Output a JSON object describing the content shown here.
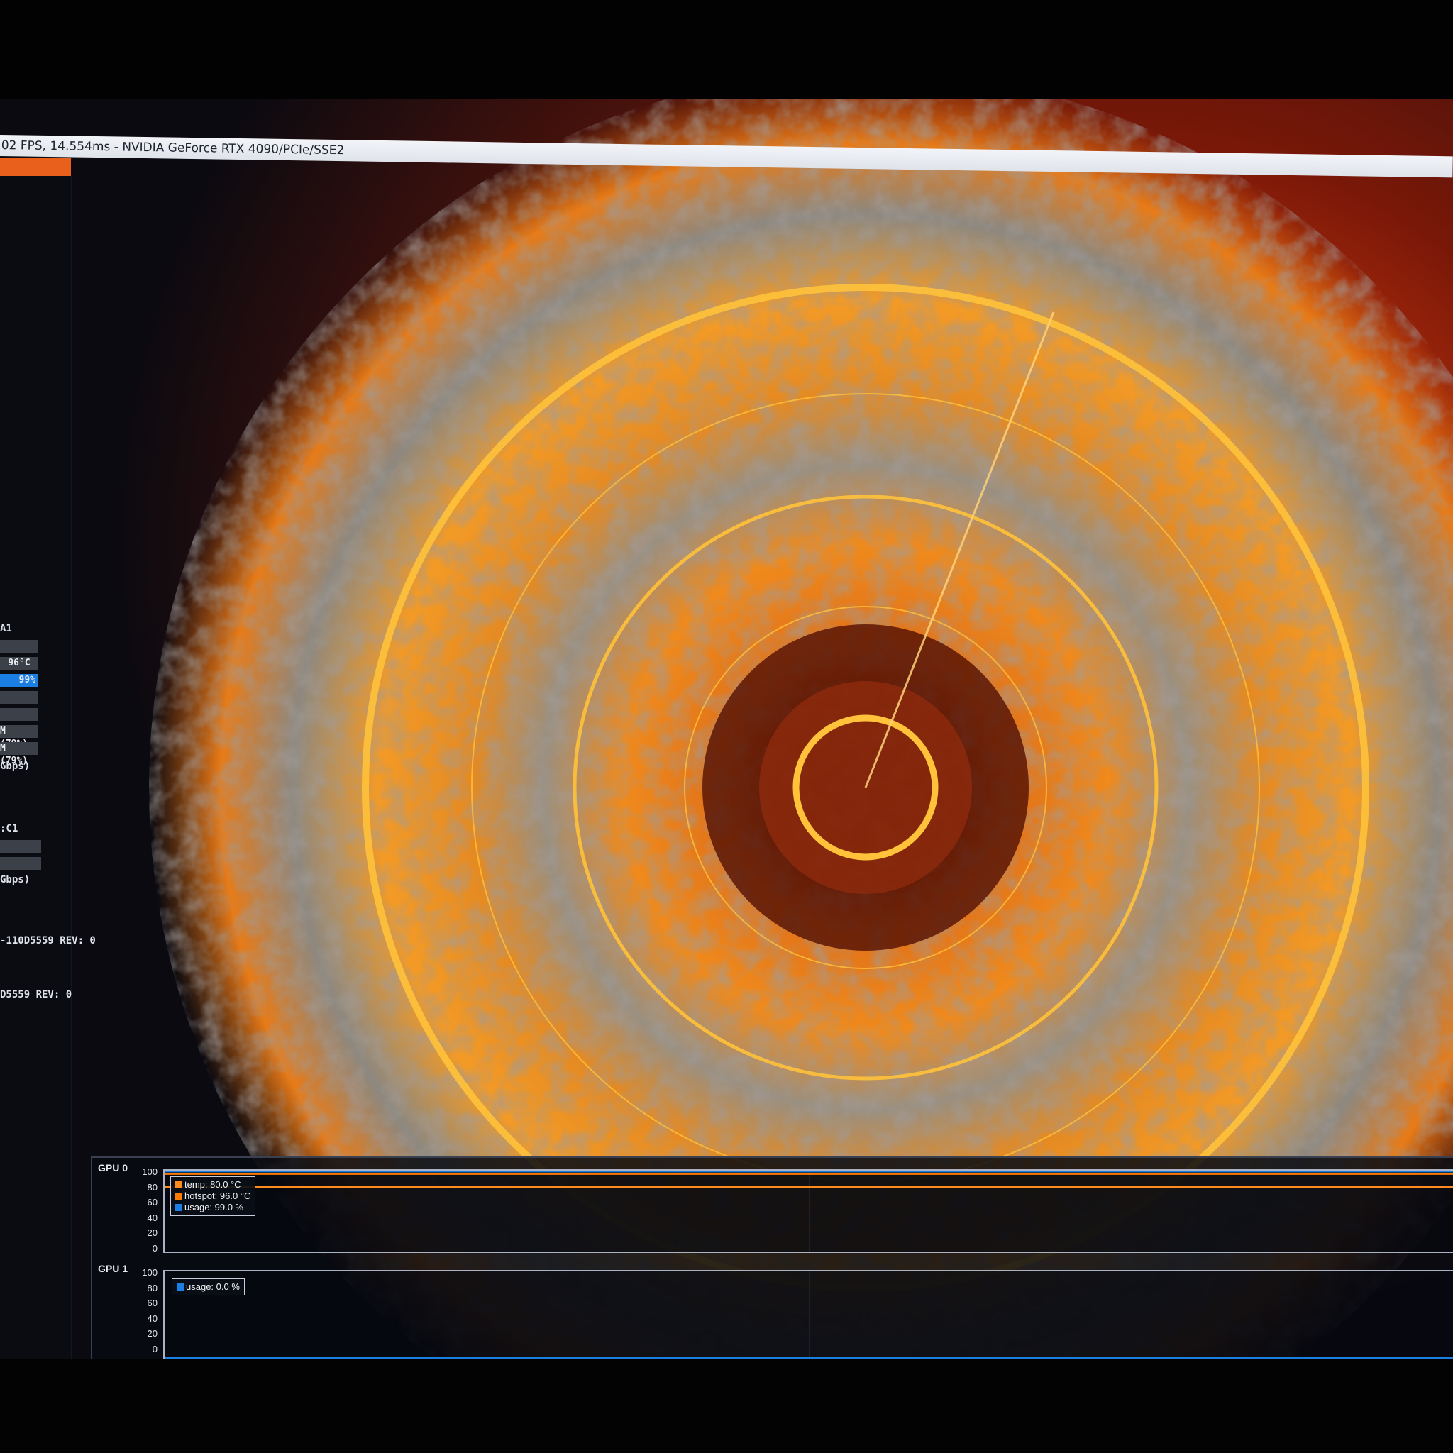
{
  "window": {
    "title": "02 FPS, 14.554ms - NVIDIA GeForce RTX 4090/PCIe/SSE2"
  },
  "left_panel": {
    "gpu0_header": "A1",
    "gpu0_temp": "96°C",
    "gpu0_usage": "99%",
    "gpu0_mem1": "M (79%)",
    "gpu0_mem2": "M (79%)",
    "gpu0_bandwidth": "Gbps)",
    "gpu1_header": ":C1",
    "gpu1_bandwidth": "Gbps)",
    "device_line1": "-110D5559 REV: 0",
    "device_line2": "D5559 REV: 0",
    "usage_fill": 0.99
  },
  "colors": {
    "accent": "#e95f1c",
    "temp": "#ff8a1e",
    "hotspot": "#ff7a00",
    "usage": "#1a7ee3",
    "rings": "#ffc23a"
  },
  "monitor": {
    "gpu0": {
      "label": "GPU 0",
      "yticks": [
        "100",
        "80",
        "60",
        "40",
        "20",
        "0"
      ],
      "legend": [
        {
          "label": "temp: 80.0 °C",
          "color": "#ff8a1e"
        },
        {
          "label": "hotspot: 96.0 °C",
          "color": "#ff7a00"
        },
        {
          "label": "usage: 99.0 %",
          "color": "#1a7ee3"
        }
      ]
    },
    "gpu1": {
      "label": "GPU 1",
      "yticks": [
        "100",
        "80",
        "60",
        "40",
        "20",
        "0"
      ],
      "legend": [
        {
          "label": "usage: 0.0 %",
          "color": "#1a7ee3"
        }
      ]
    }
  },
  "chart_data": [
    {
      "type": "line",
      "ylim": [
        0,
        100
      ],
      "series": [
        {
          "name": "temp",
          "values": [
            80,
            80,
            80,
            80,
            80,
            80,
            80,
            80,
            80,
            80,
            80,
            80
          ]
        },
        {
          "name": "hotspot",
          "values": [
            96,
            96,
            96,
            96,
            96,
            96,
            96,
            96,
            96,
            96,
            96,
            96
          ]
        },
        {
          "name": "usage",
          "values": [
            99,
            99,
            99,
            99,
            99,
            99,
            99,
            99,
            99,
            99,
            99,
            99
          ]
        }
      ]
    },
    {
      "type": "line",
      "ylim": [
        0,
        100
      ],
      "series": [
        {
          "name": "usage",
          "values": [
            0,
            0,
            0,
            0,
            0,
            0,
            0,
            0,
            0,
            0,
            0,
            0
          ]
        }
      ]
    }
  ]
}
